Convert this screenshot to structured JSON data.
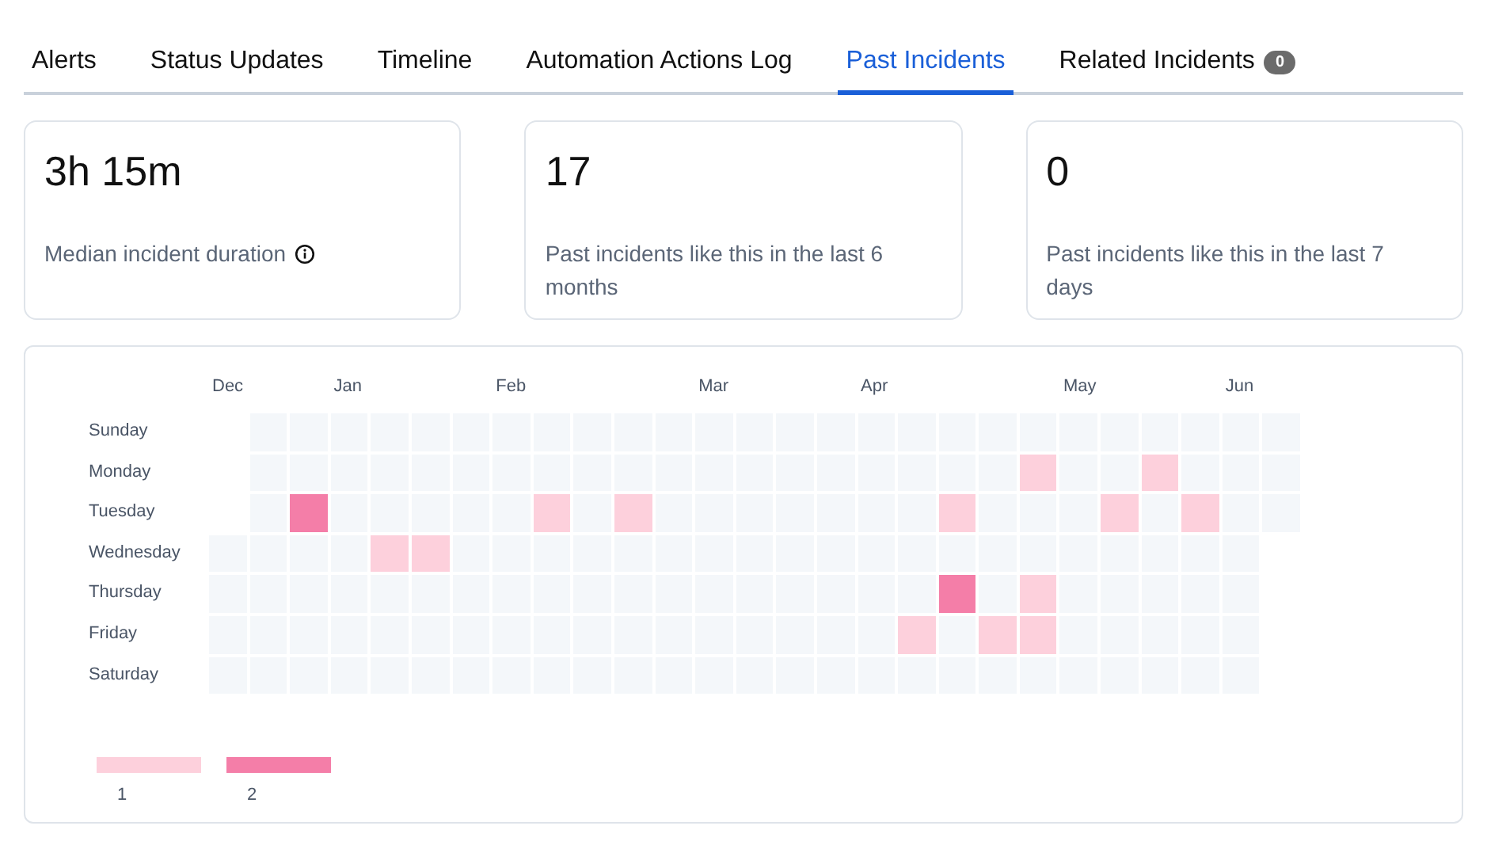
{
  "tabs": [
    {
      "label": "Alerts",
      "selected": false
    },
    {
      "label": "Status Updates",
      "selected": false
    },
    {
      "label": "Timeline",
      "selected": false
    },
    {
      "label": "Automation Actions Log",
      "selected": false
    },
    {
      "label": "Past Incidents",
      "selected": true
    },
    {
      "label": "Related Incidents",
      "selected": false,
      "badge": "0"
    }
  ],
  "stats": [
    {
      "value": "3h 15m",
      "label": "Median incident duration",
      "info": true
    },
    {
      "value": "17",
      "label": "Past incidents like this in the last 6 months",
      "info": false
    },
    {
      "value": "0",
      "label": "Past incidents like this in the last 7 days",
      "info": false
    }
  ],
  "heatmap": {
    "days": [
      "Sunday",
      "Monday",
      "Tuesday",
      "Wednesday",
      "Thursday",
      "Friday",
      "Saturday"
    ],
    "weeks": [
      {
        "month": "Dec",
        "cells": [
          null,
          null,
          null,
          {
            "color": "#f4f7fa"
          },
          {
            "color": "#f4f7fa"
          },
          {
            "color": "#f4f7fa"
          },
          {
            "color": "#f4f7fa"
          }
        ]
      },
      {
        "cells": [
          {
            "color": "#f4f7fa"
          },
          {
            "color": "#f4f7fa"
          },
          {
            "color": "#f4f7fa"
          },
          {
            "color": "#f4f7fa"
          },
          {
            "color": "#f4f7fa"
          },
          {
            "color": "#f4f7fa"
          },
          {
            "color": "#f4f7fa"
          }
        ]
      },
      {
        "cells": [
          {
            "color": "#f4f7fa"
          },
          {
            "color": "#f4f7fa"
          },
          {
            "color": "#f47ea8"
          },
          {
            "color": "#f4f7fa"
          },
          {
            "color": "#f4f7fa"
          },
          {
            "color": "#f4f7fa"
          },
          {
            "color": "#f4f7fa"
          }
        ]
      },
      {
        "month": "Jan",
        "cells": [
          {
            "color": "#f4f7fa"
          },
          {
            "color": "#f4f7fa"
          },
          {
            "color": "#f4f7fa"
          },
          {
            "color": "#f4f7fa"
          },
          {
            "color": "#f4f7fa"
          },
          {
            "color": "#f4f7fa"
          },
          {
            "color": "#f4f7fa"
          }
        ]
      },
      {
        "cells": [
          {
            "color": "#f4f7fa"
          },
          {
            "color": "#f4f7fa"
          },
          {
            "color": "#f4f7fa"
          },
          {
            "color": "#fdd0dc"
          },
          {
            "color": "#f4f7fa"
          },
          {
            "color": "#f4f7fa"
          },
          {
            "color": "#f4f7fa"
          }
        ]
      },
      {
        "cells": [
          {
            "color": "#f4f7fa"
          },
          {
            "color": "#f4f7fa"
          },
          {
            "color": "#f4f7fa"
          },
          {
            "color": "#fdd0dc"
          },
          {
            "color": "#f4f7fa"
          },
          {
            "color": "#f4f7fa"
          },
          {
            "color": "#f4f7fa"
          }
        ]
      },
      {
        "cells": [
          {
            "color": "#f4f7fa"
          },
          {
            "color": "#f4f7fa"
          },
          {
            "color": "#f4f7fa"
          },
          {
            "color": "#f4f7fa"
          },
          {
            "color": "#f4f7fa"
          },
          {
            "color": "#f4f7fa"
          },
          {
            "color": "#f4f7fa"
          }
        ]
      },
      {
        "month": "Feb",
        "cells": [
          {
            "color": "#f4f7fa"
          },
          {
            "color": "#f4f7fa"
          },
          {
            "color": "#f4f7fa"
          },
          {
            "color": "#f4f7fa"
          },
          {
            "color": "#f4f7fa"
          },
          {
            "color": "#f4f7fa"
          },
          {
            "color": "#f4f7fa"
          }
        ]
      },
      {
        "cells": [
          {
            "color": "#f4f7fa"
          },
          {
            "color": "#f4f7fa"
          },
          {
            "color": "#fdd0dc"
          },
          {
            "color": "#f4f7fa"
          },
          {
            "color": "#f4f7fa"
          },
          {
            "color": "#f4f7fa"
          },
          {
            "color": "#f4f7fa"
          }
        ]
      },
      {
        "cells": [
          {
            "color": "#f4f7fa"
          },
          {
            "color": "#f4f7fa"
          },
          {
            "color": "#f4f7fa"
          },
          {
            "color": "#f4f7fa"
          },
          {
            "color": "#f4f7fa"
          },
          {
            "color": "#f4f7fa"
          },
          {
            "color": "#f4f7fa"
          }
        ]
      },
      {
        "cells": [
          {
            "color": "#f4f7fa"
          },
          {
            "color": "#f4f7fa"
          },
          {
            "color": "#fdd0dc"
          },
          {
            "color": "#f4f7fa"
          },
          {
            "color": "#f4f7fa"
          },
          {
            "color": "#f4f7fa"
          },
          {
            "color": "#f4f7fa"
          }
        ]
      },
      {
        "cells": [
          {
            "color": "#f4f7fa"
          },
          {
            "color": "#f4f7fa"
          },
          {
            "color": "#f4f7fa"
          },
          {
            "color": "#f4f7fa"
          },
          {
            "color": "#f4f7fa"
          },
          {
            "color": "#f4f7fa"
          },
          {
            "color": "#f4f7fa"
          }
        ]
      },
      {
        "month": "Mar",
        "cells": [
          {
            "color": "#f4f7fa"
          },
          {
            "color": "#f4f7fa"
          },
          {
            "color": "#f4f7fa"
          },
          {
            "color": "#f4f7fa"
          },
          {
            "color": "#f4f7fa"
          },
          {
            "color": "#f4f7fa"
          },
          {
            "color": "#f4f7fa"
          }
        ]
      },
      {
        "cells": [
          {
            "color": "#f4f7fa"
          },
          {
            "color": "#f4f7fa"
          },
          {
            "color": "#f4f7fa"
          },
          {
            "color": "#f4f7fa"
          },
          {
            "color": "#f4f7fa"
          },
          {
            "color": "#f4f7fa"
          },
          {
            "color": "#f4f7fa"
          }
        ]
      },
      {
        "cells": [
          {
            "color": "#f4f7fa"
          },
          {
            "color": "#f4f7fa"
          },
          {
            "color": "#f4f7fa"
          },
          {
            "color": "#f4f7fa"
          },
          {
            "color": "#f4f7fa"
          },
          {
            "color": "#f4f7fa"
          },
          {
            "color": "#f4f7fa"
          }
        ]
      },
      {
        "cells": [
          {
            "color": "#f4f7fa"
          },
          {
            "color": "#f4f7fa"
          },
          {
            "color": "#f4f7fa"
          },
          {
            "color": "#f4f7fa"
          },
          {
            "color": "#f4f7fa"
          },
          {
            "color": "#f4f7fa"
          },
          {
            "color": "#f4f7fa"
          }
        ]
      },
      {
        "month": "Apr",
        "cells": [
          {
            "color": "#f4f7fa"
          },
          {
            "color": "#f4f7fa"
          },
          {
            "color": "#f4f7fa"
          },
          {
            "color": "#f4f7fa"
          },
          {
            "color": "#f4f7fa"
          },
          {
            "color": "#f4f7fa"
          },
          {
            "color": "#f4f7fa"
          }
        ]
      },
      {
        "cells": [
          {
            "color": "#f4f7fa"
          },
          {
            "color": "#f4f7fa"
          },
          {
            "color": "#f4f7fa"
          },
          {
            "color": "#f4f7fa"
          },
          {
            "color": "#f4f7fa"
          },
          {
            "color": "#fdd0dc"
          },
          {
            "color": "#f4f7fa"
          }
        ]
      },
      {
        "cells": [
          {
            "color": "#f4f7fa"
          },
          {
            "color": "#f4f7fa"
          },
          {
            "color": "#fdd0dc"
          },
          {
            "color": "#f4f7fa"
          },
          {
            "color": "#f47ea8"
          },
          {
            "color": "#f4f7fa"
          },
          {
            "color": "#f4f7fa"
          }
        ]
      },
      {
        "cells": [
          {
            "color": "#f4f7fa"
          },
          {
            "color": "#f4f7fa"
          },
          {
            "color": "#f4f7fa"
          },
          {
            "color": "#f4f7fa"
          },
          {
            "color": "#f4f7fa"
          },
          {
            "color": "#fdd0dc"
          },
          {
            "color": "#f4f7fa"
          }
        ]
      },
      {
        "cells": [
          {
            "color": "#f4f7fa"
          },
          {
            "color": "#fdd0dc"
          },
          {
            "color": "#f4f7fa"
          },
          {
            "color": "#f4f7fa"
          },
          {
            "color": "#fdd0dc"
          },
          {
            "color": "#fdd0dc"
          },
          {
            "color": "#f4f7fa"
          }
        ]
      },
      {
        "month": "May",
        "cells": [
          {
            "color": "#f4f7fa"
          },
          {
            "color": "#f4f7fa"
          },
          {
            "color": "#f4f7fa"
          },
          {
            "color": "#f4f7fa"
          },
          {
            "color": "#f4f7fa"
          },
          {
            "color": "#f4f7fa"
          },
          {
            "color": "#f4f7fa"
          }
        ]
      },
      {
        "cells": [
          {
            "color": "#f4f7fa"
          },
          {
            "color": "#f4f7fa"
          },
          {
            "color": "#fdd0dc"
          },
          {
            "color": "#f4f7fa"
          },
          {
            "color": "#f4f7fa"
          },
          {
            "color": "#f4f7fa"
          },
          {
            "color": "#f4f7fa"
          }
        ]
      },
      {
        "cells": [
          {
            "color": "#f4f7fa"
          },
          {
            "color": "#fdd0dc"
          },
          {
            "color": "#f4f7fa"
          },
          {
            "color": "#f4f7fa"
          },
          {
            "color": "#f4f7fa"
          },
          {
            "color": "#f4f7fa"
          },
          {
            "color": "#f4f7fa"
          }
        ]
      },
      {
        "cells": [
          {
            "color": "#f4f7fa"
          },
          {
            "color": "#f4f7fa"
          },
          {
            "color": "#fdd0dc"
          },
          {
            "color": "#f4f7fa"
          },
          {
            "color": "#f4f7fa"
          },
          {
            "color": "#f4f7fa"
          },
          {
            "color": "#f4f7fa"
          }
        ]
      },
      {
        "month": "Jun",
        "cells": [
          {
            "color": "#f4f7fa"
          },
          {
            "color": "#f4f7fa"
          },
          {
            "color": "#f4f7fa"
          },
          {
            "color": "#f4f7fa"
          },
          {
            "color": "#f4f7fa"
          },
          {
            "color": "#f4f7fa"
          },
          {
            "color": "#f4f7fa"
          }
        ]
      },
      {
        "cells": [
          {
            "color": "#f4f7fa"
          },
          {
            "color": "#f4f7fa"
          },
          {
            "color": "#f4f7fa"
          },
          null,
          null,
          null,
          null
        ]
      }
    ],
    "legend": [
      {
        "label": "1",
        "color": "#fdd0dc"
      },
      {
        "label": "2",
        "color": "#f47ea8"
      }
    ]
  }
}
